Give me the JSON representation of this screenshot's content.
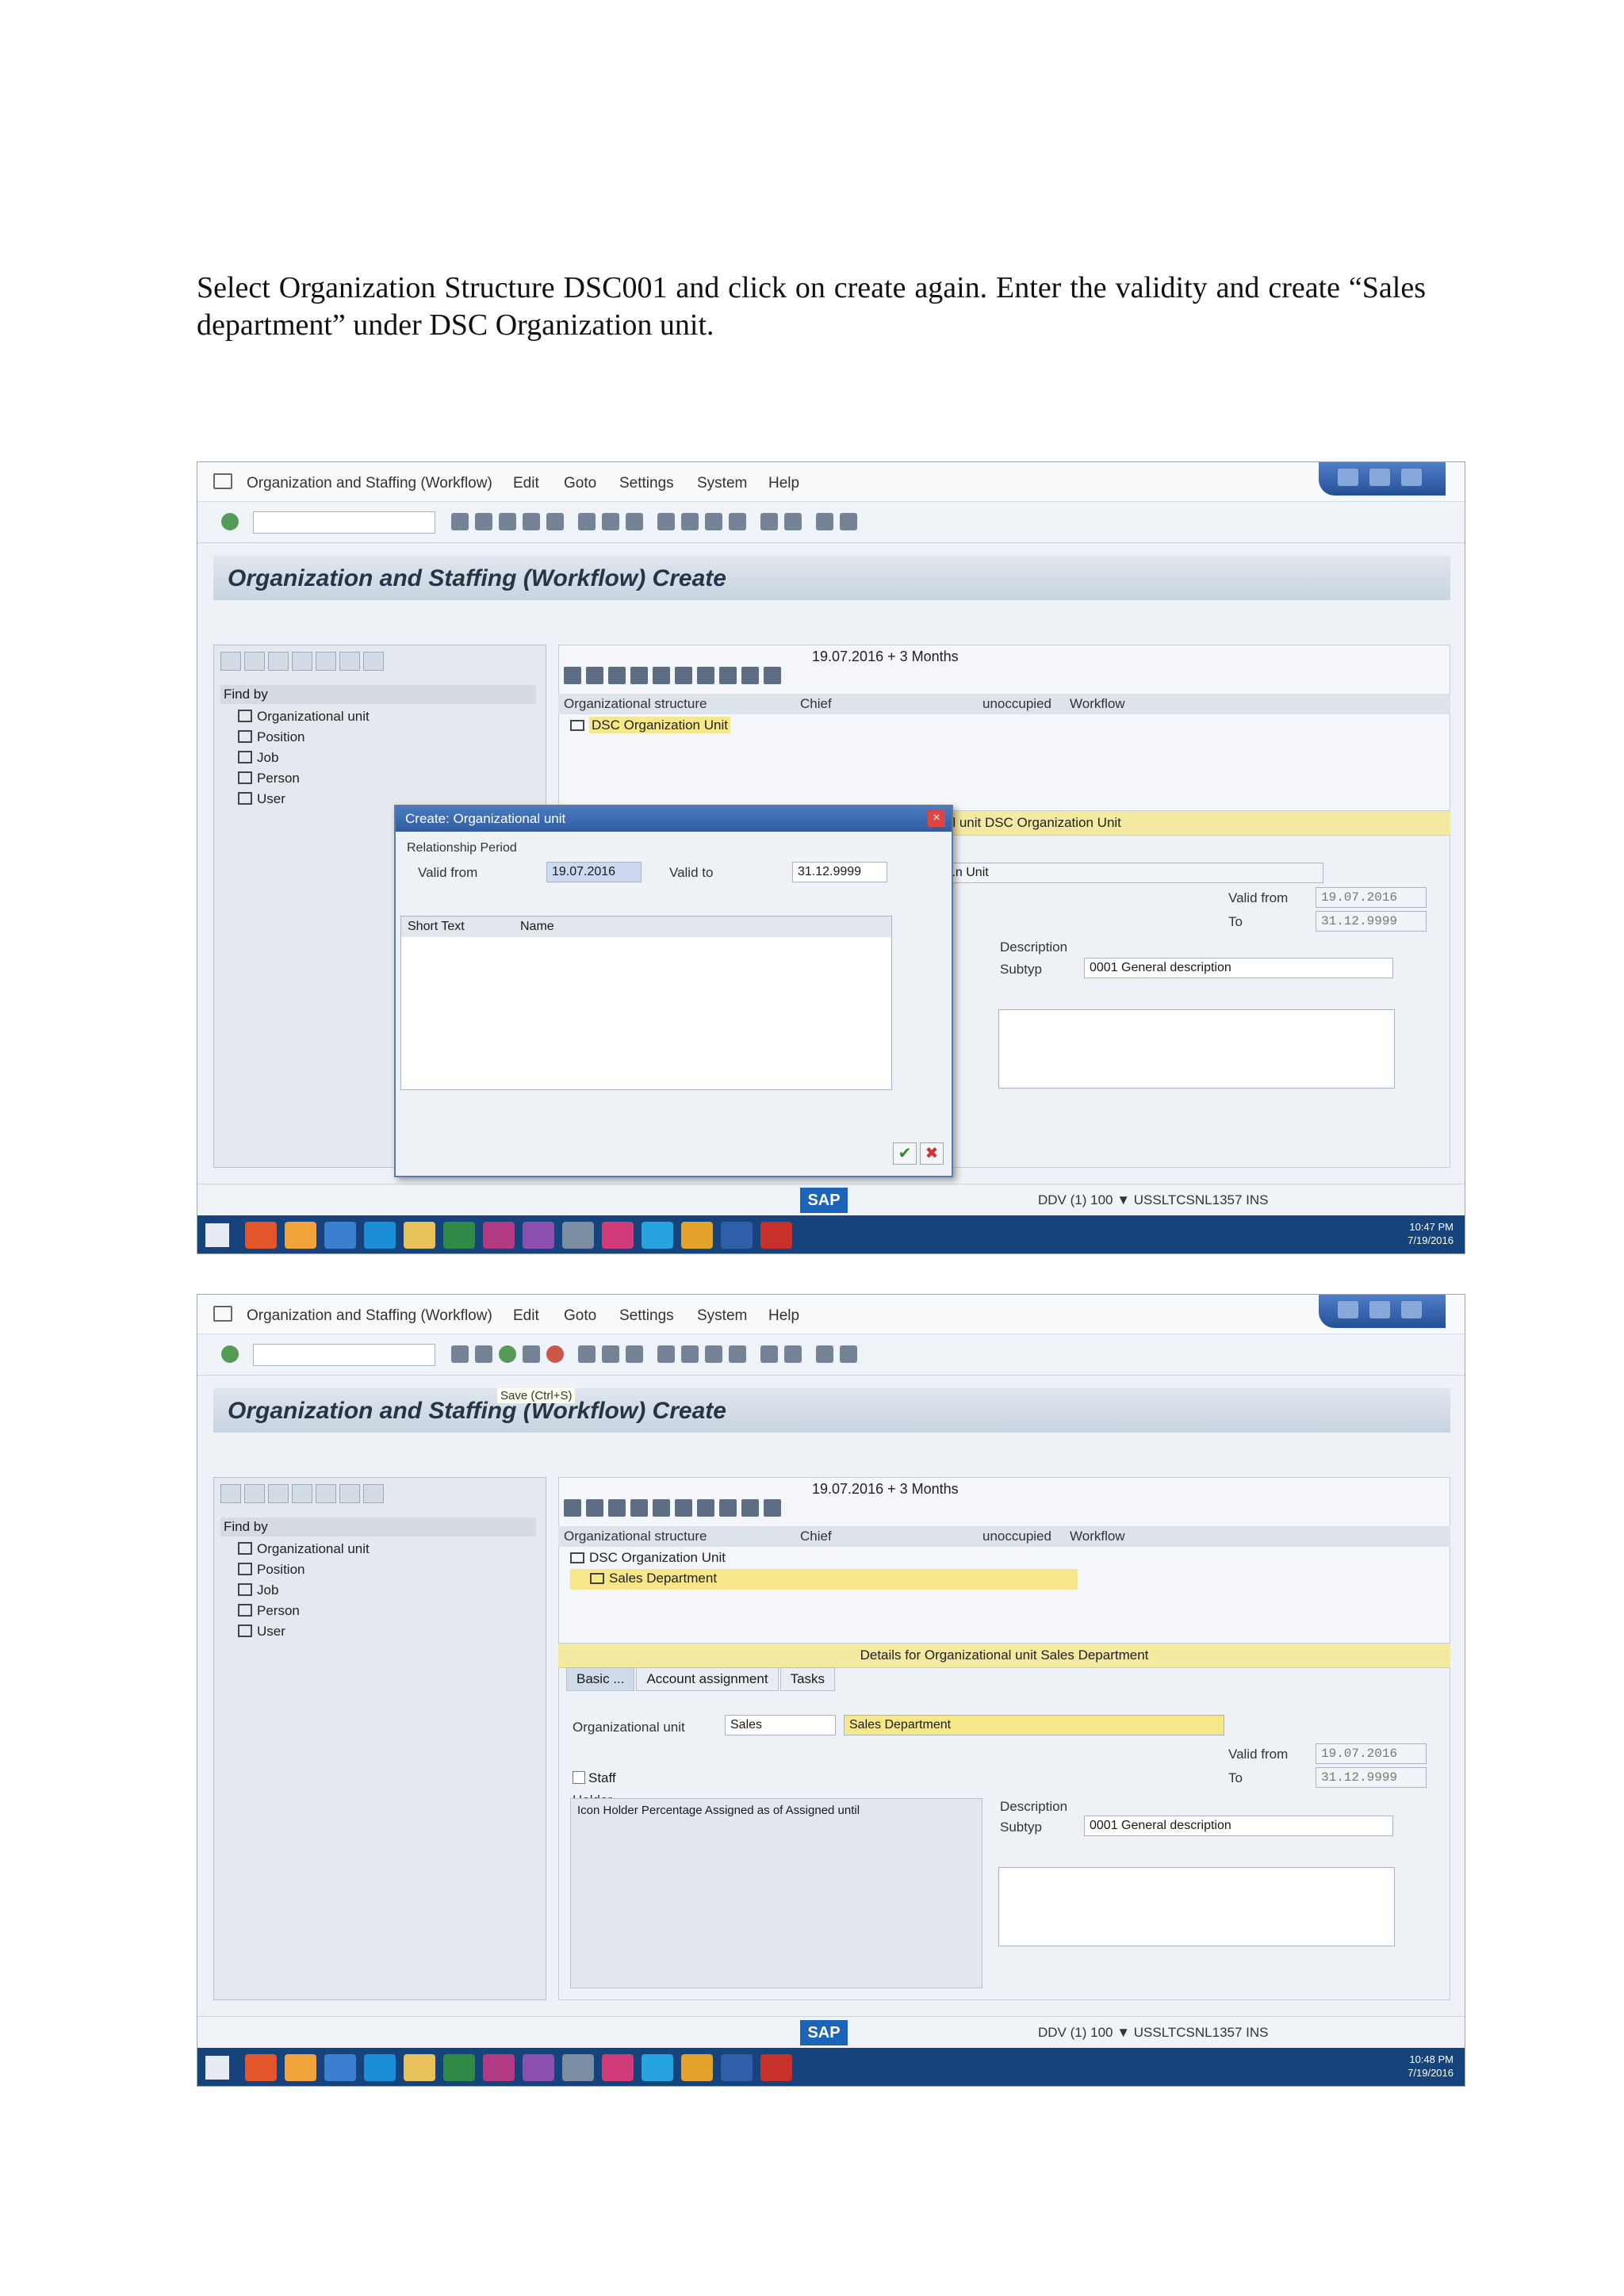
{
  "doc": {
    "paragraph": "Select Organization Structure DSC001 and click on create again. Enter the validity and create “Sales department” under DSC Organization unit."
  },
  "sap": {
    "menu": [
      "Organization and Staffing (Workflow)",
      "Edit",
      "Goto",
      "Settings",
      "System",
      "Help"
    ],
    "screen_title": "Organization and Staffing (Workflow) Create",
    "date_display": "19.07.2016 + 3 Months",
    "find_by": "Find by",
    "tree": [
      "Organizational unit",
      "Position",
      "Job",
      "Person",
      "User"
    ],
    "columns": {
      "org": "Organizational structure",
      "chief": "Chief",
      "unoccupied": "unoccupied",
      "workflow": "Workflow"
    },
    "org_root": "DSC Organization Unit",
    "org_child": "Sales Department",
    "valid_from": "Valid from",
    "to": "To",
    "date_from": "19.07.2016",
    "date_to": "31.12.9999",
    "description": "Description",
    "subtype_label": "Subtyp",
    "subtype_value": "0001 General description",
    "status": "DDV (1) 100 ▼  USSLTCSNL1357  INS",
    "sap_logo": "SAP"
  },
  "shot1": {
    "details_bar": "...nizational unit DSC Organization Unit",
    "unit_text": "..n Unit",
    "clock_time": "10:47 PM",
    "clock_date": "7/19/2016",
    "dialog": {
      "title": "Create: Organizational unit",
      "section": "Relationship Period",
      "valid_from_label": "Valid from",
      "valid_from": "19.07.2016",
      "valid_to_label": "Valid to",
      "valid_to": "31.12.9999",
      "col_short": "Short Text",
      "col_name": "Name"
    }
  },
  "shot2": {
    "tooltip": "Save   (Ctrl+S)",
    "details_bar": "Details for Organizational unit Sales Department",
    "tabs": [
      "Basic ...",
      "Account assignment",
      "Tasks"
    ],
    "org_unit_label": "Organizational unit",
    "org_unit_short": "Sales",
    "org_unit_name": "Sales Department",
    "staff_label": "Staff",
    "holder_label": "Holder",
    "holder_cols": "Icon  Holder  Percentage  Assigned as of  Assigned until",
    "clock_time": "10:48 PM",
    "clock_date": "7/19/2016"
  }
}
